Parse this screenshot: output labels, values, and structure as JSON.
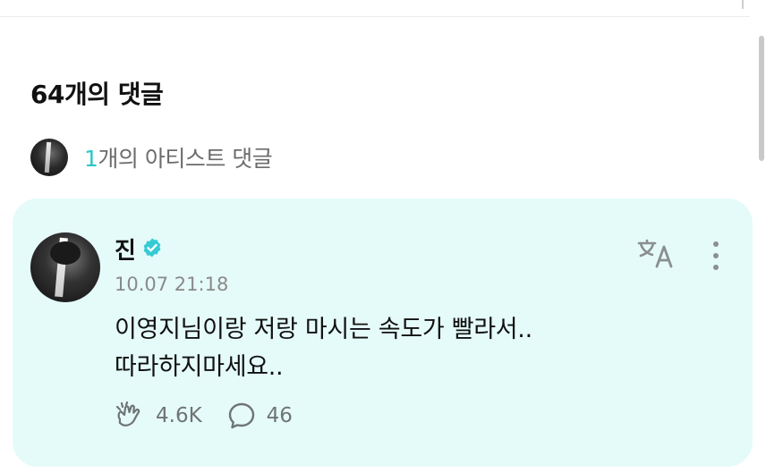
{
  "comments": {
    "title": "64개의 댓글",
    "artist_count": "1",
    "artist_suffix": "개의 아티스트 댓글"
  },
  "comment": {
    "author": "진",
    "verified": true,
    "timestamp": "10.07 21:18",
    "lines": [
      "이영지님이랑 저랑 마시는 속도가 빨라서..",
      "따라하지마세요.."
    ],
    "cheer_count": "4.6K",
    "reply_count": "46"
  },
  "colors": {
    "accent": "#2cc6c6",
    "card_bg": "#e5fbf9",
    "verified": "#35cbd4"
  },
  "icons": {
    "verified": "verified-badge-icon",
    "translate": "translate-icon",
    "more": "more-vertical-icon",
    "cheer": "cheer-hands-icon",
    "reply": "speech-bubble-icon"
  }
}
